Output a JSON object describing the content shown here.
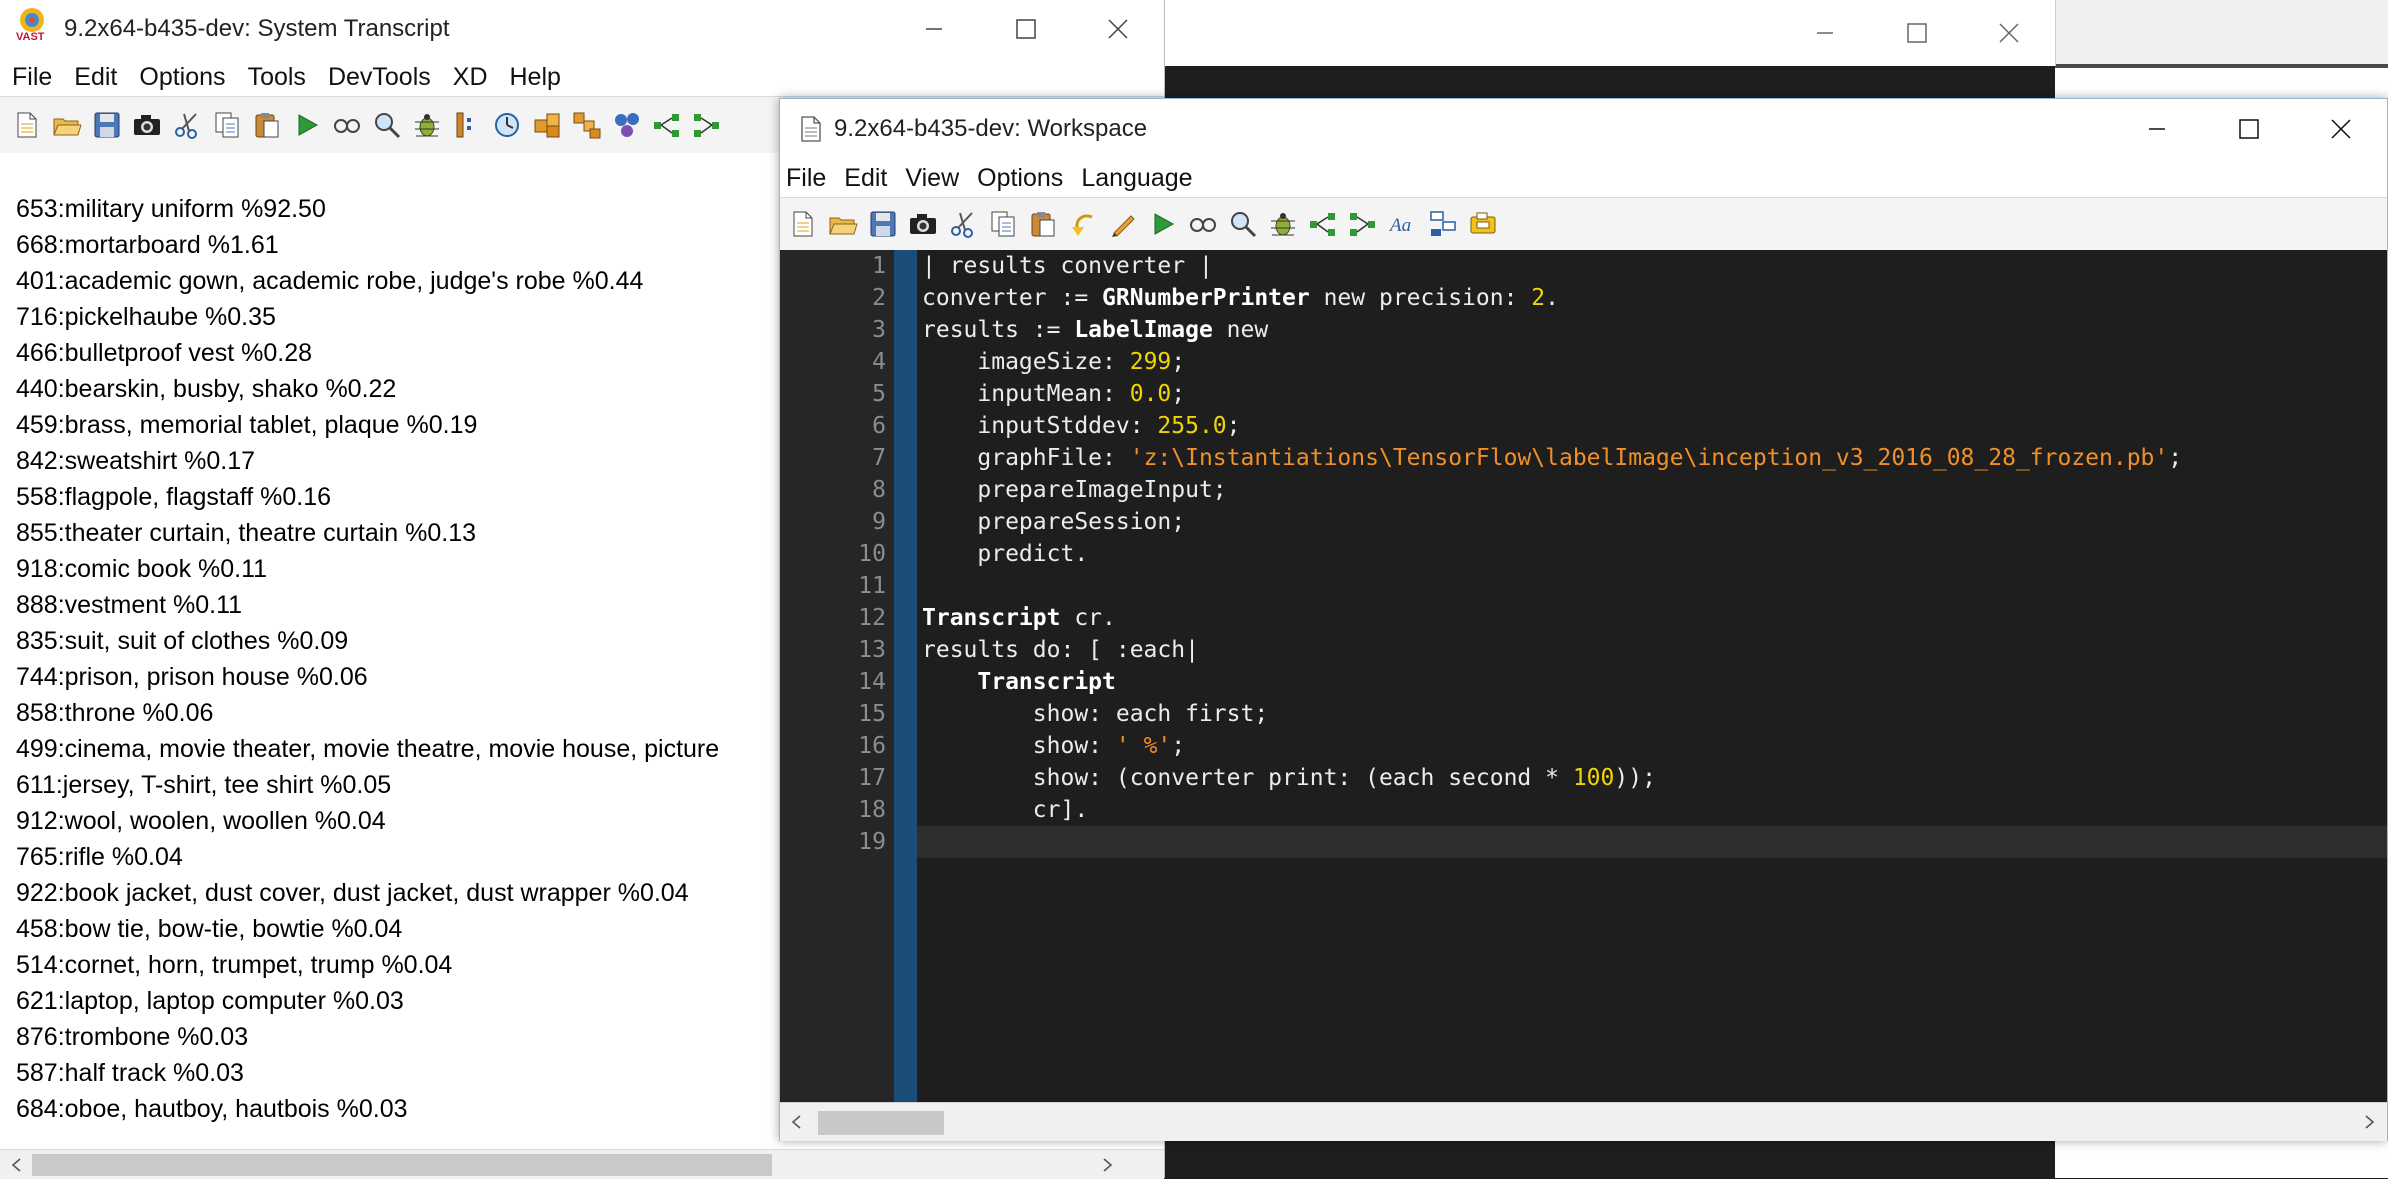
{
  "background_window": {
    "controls": [
      "minimize",
      "maximize",
      "close"
    ]
  },
  "transcript_window": {
    "title": "9.2x64-b435-dev: System Transcript",
    "app_icon_label": "VAST",
    "menu": [
      "File",
      "Edit",
      "Options",
      "Tools",
      "DevTools",
      "XD",
      "Help"
    ],
    "toolbar_icons": [
      "new-file-icon",
      "open-folder-icon",
      "save-icon",
      "camera-icon",
      "scissors-icon",
      "copy-icon",
      "paste-icon",
      "run-icon",
      "inspect-icon",
      "search-icon",
      "debug-bug-icon",
      "browser-icon",
      "clock-icon",
      "package-icon",
      "packages-icon",
      "molecule-icon",
      "hierarchy-icon",
      "hierarchy2-icon"
    ],
    "lines": [
      "653:military uniform %92.50",
      "668:mortarboard %1.61",
      "401:academic gown, academic robe, judge's robe %0.44",
      "716:pickelhaube %0.35",
      "466:bulletproof vest %0.28",
      "440:bearskin, busby, shako %0.22",
      "459:brass, memorial tablet, plaque %0.19",
      "842:sweatshirt %0.17",
      "558:flagpole, flagstaff %0.16",
      "855:theater curtain, theatre curtain %0.13",
      "918:comic book %0.11",
      "888:vestment %0.11",
      "835:suit, suit of clothes %0.09",
      "744:prison, prison house %0.06",
      "858:throne %0.06",
      "499:cinema, movie theater, movie theatre, movie house, picture",
      "611:jersey, T-shirt, tee shirt %0.05",
      "912:wool, woolen, woollen %0.04",
      "765:rifle %0.04",
      "922:book jacket, dust cover, dust jacket, dust wrapper %0.04",
      "458:bow tie, bow-tie, bowtie %0.04",
      "514:cornet, horn, trumpet, trump %0.04",
      "621:laptop, laptop computer %0.03",
      "876:trombone %0.03",
      "587:half track %0.03",
      "684:oboe, hautboy, hautbois %0.03"
    ]
  },
  "workspace_window": {
    "title": "9.2x64-b435-dev: Workspace",
    "menu": [
      "File",
      "Edit",
      "View",
      "Options",
      "Language"
    ],
    "toolbar_icons": [
      "new-file-icon",
      "open-folder-icon",
      "save-icon",
      "camera-icon",
      "scissors-icon",
      "copy-icon",
      "paste-icon",
      "undo-icon",
      "pencil-icon",
      "run-icon",
      "inspect-icon",
      "search-icon",
      "debug-bug-icon",
      "hierarchy-icon",
      "hierarchy2-icon",
      "font-icon",
      "layout-icon",
      "comment-icon"
    ],
    "line_numbers": [
      "1",
      "2",
      "3",
      "4",
      "5",
      "6",
      "7",
      "8",
      "9",
      "10",
      "11",
      "12",
      "13",
      "14",
      "15",
      "16",
      "17",
      "18",
      "19"
    ],
    "code": [
      [
        {
          "t": "| results converter |"
        }
      ],
      [
        {
          "t": "converter := "
        },
        {
          "t": "GRNumberPrinter",
          "c": "k"
        },
        {
          "t": " new precision: "
        },
        {
          "t": "2",
          "c": "n"
        },
        {
          "t": "."
        }
      ],
      [
        {
          "t": "results := "
        },
        {
          "t": "LabelImage",
          "c": "k"
        },
        {
          "t": " new"
        }
      ],
      [
        {
          "t": "    imageSize: "
        },
        {
          "t": "299",
          "c": "n"
        },
        {
          "t": ";"
        }
      ],
      [
        {
          "t": "    inputMean: "
        },
        {
          "t": "0.0",
          "c": "n"
        },
        {
          "t": ";"
        }
      ],
      [
        {
          "t": "    inputStddev: "
        },
        {
          "t": "255.0",
          "c": "n"
        },
        {
          "t": ";"
        }
      ],
      [
        {
          "t": "    graphFile: "
        },
        {
          "t": "'z:\\Instantiations\\TensorFlow\\labelImage\\inception_v3_2016_08_28_frozen.pb'",
          "c": "s"
        },
        {
          "t": ";"
        }
      ],
      [
        {
          "t": "    prepareImageInput;"
        }
      ],
      [
        {
          "t": "    prepareSession;"
        }
      ],
      [
        {
          "t": "    predict."
        }
      ],
      [
        {
          "t": ""
        }
      ],
      [
        {
          "t": "Transcript",
          "c": "k"
        },
        {
          "t": " cr."
        }
      ],
      [
        {
          "t": "results do: [ :each|"
        }
      ],
      [
        {
          "t": "    "
        },
        {
          "t": "Transcript",
          "c": "k"
        }
      ],
      [
        {
          "t": "        show: each first;"
        }
      ],
      [
        {
          "t": "        show: "
        },
        {
          "t": "' %'",
          "c": "s"
        },
        {
          "t": ";"
        }
      ],
      [
        {
          "t": "        show: (converter print: (each second * "
        },
        {
          "t": "100",
          "c": "n"
        },
        {
          "t": "));"
        }
      ],
      [
        {
          "t": "        cr]."
        }
      ],
      [
        {
          "t": ""
        }
      ]
    ],
    "current_line": 19
  }
}
